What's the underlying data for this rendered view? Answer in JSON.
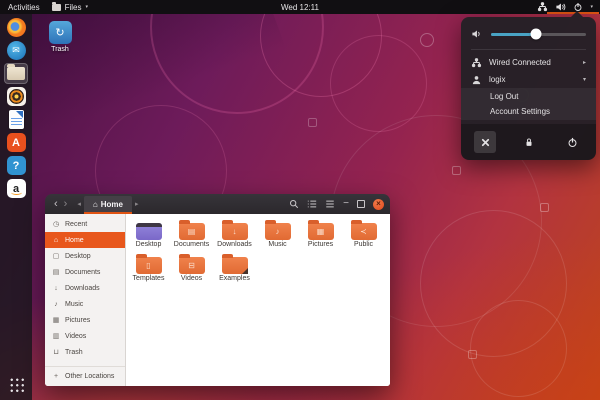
{
  "colors": {
    "accent": "#E95420",
    "slider_fill": "#49A3C4",
    "folder_orange": "#ED7546",
    "desktop_folder_purple": "#8878D0",
    "sidebar_selected": "#E8571C",
    "close_button": "#E2491C"
  },
  "topbar": {
    "activities": "Activities",
    "app_menu_label": "Files",
    "clock": "Wed 12:11"
  },
  "glyphs": {
    "caret_down": "▾",
    "back": "‹",
    "forward": "›",
    "scroll_left": "◂",
    "scroll_right": "▸",
    "home": "⌂",
    "minimize": "−",
    "close": "×",
    "submenu_arrow": "▸",
    "trash_emblem": "↻"
  },
  "desktop": {
    "trash_label": "Trash"
  },
  "dock": {
    "apps": [
      "firefox",
      "thunderbird",
      "files",
      "rhythmbox",
      "libreoffice-writer",
      "ubuntu-software",
      "help",
      "amazon"
    ],
    "software_letter": "A",
    "help_letter": "?",
    "amazon_letter": "a"
  },
  "system_menu": {
    "volume_percent": 47,
    "wired_label": "Wired Connected",
    "user_label": "logix",
    "log_out_label": "Log Out",
    "account_settings_label": "Account Settings"
  },
  "window": {
    "title": "Home",
    "sidebar": {
      "items": [
        {
          "glyph": "◷",
          "label": "Recent"
        },
        {
          "glyph": "⌂",
          "label": "Home"
        },
        {
          "glyph": "▢",
          "label": "Desktop"
        },
        {
          "glyph": "▤",
          "label": "Documents"
        },
        {
          "glyph": "↓",
          "label": "Downloads"
        },
        {
          "glyph": "♪",
          "label": "Music"
        },
        {
          "glyph": "▦",
          "label": "Pictures"
        },
        {
          "glyph": "▥",
          "label": "Videos"
        },
        {
          "glyph": "⊔",
          "label": "Trash"
        },
        {
          "glyph": "+",
          "label": "Other Locations"
        }
      ]
    },
    "files": {
      "items": [
        {
          "label": "Desktop",
          "kind": "desktop",
          "emblem": ""
        },
        {
          "label": "Documents",
          "kind": "folder",
          "emblem": "▤"
        },
        {
          "label": "Downloads",
          "kind": "folder",
          "emblem": "↓"
        },
        {
          "label": "Music",
          "kind": "folder",
          "emblem": "♪"
        },
        {
          "label": "Pictures",
          "kind": "folder",
          "emblem": "▦"
        },
        {
          "label": "Public",
          "kind": "folder",
          "emblem": "≺"
        },
        {
          "label": "Templates",
          "kind": "folder",
          "emblem": "▯"
        },
        {
          "label": "Videos",
          "kind": "folder",
          "emblem": "⊟"
        },
        {
          "label": "Examples",
          "kind": "examples",
          "emblem": ""
        }
      ]
    }
  }
}
